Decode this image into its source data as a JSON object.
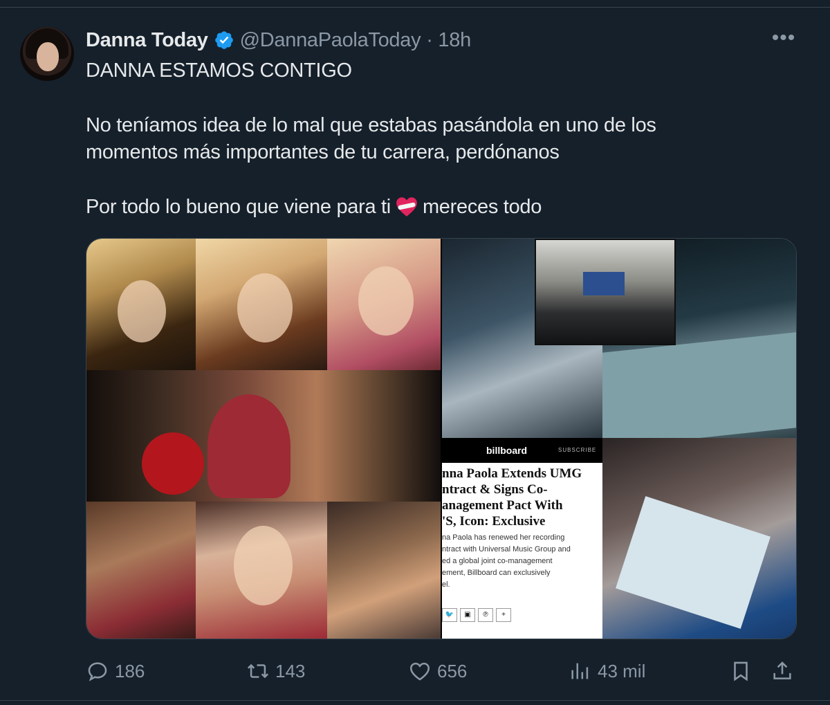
{
  "tweet": {
    "author_name": "Danna Today",
    "handle": "@DannaPaolaToday",
    "timestamp": "· 18h",
    "more_icon": "more-horizontal-icon",
    "verified_icon": "verified-badge-icon",
    "lines": [
      "DANNA ESTAMOS CONTIGO",
      "No teníamos idea de lo mal que estabas pasándola en uno de los",
      "momentos más importantes de tu carrera, perdónanos",
      "Por todo lo bueno que viene para ti",
      "mereces todo"
    ],
    "emoji_icon": "mending-heart-icon"
  },
  "media": {
    "billboard": {
      "logo": "billboard",
      "subscribe": "SUBSCRIBE",
      "headline": "nna Paola Extends UMG\nntract & Signs Co-\nanagement Pact With\n'S, Icon: Exclusive",
      "body": "na Paola has renewed her recording\nntract with Universal Music Group and\ned a global joint co-management\nement, Billboard can exclusively\nel.",
      "share_icons": [
        "twitter-icon",
        "flipboard-icon",
        "pinterest-icon",
        "plus-icon"
      ],
      "share_glyphs": [
        "🐦",
        "▣",
        "℗",
        "+"
      ]
    }
  },
  "actions": {
    "replies": "186",
    "retweets": "143",
    "likes": "656",
    "views": "43 mil"
  },
  "colors": {
    "background": "#15202b",
    "primary_text": "#e7e9ea",
    "secondary_text": "#8b98a5",
    "verified": "#1d9bf0"
  }
}
